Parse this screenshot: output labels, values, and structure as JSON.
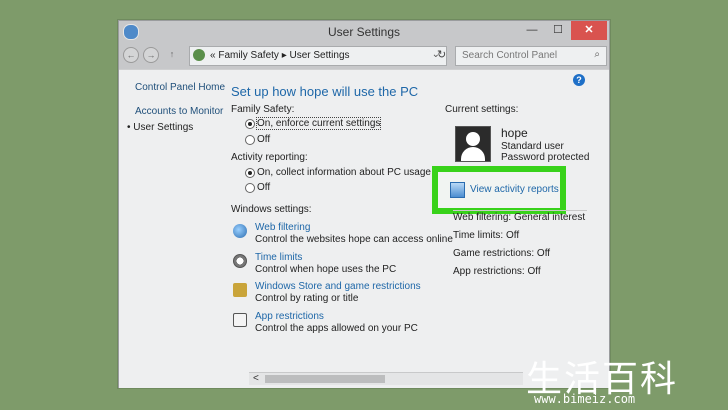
{
  "window": {
    "title": "User Settings",
    "controls": {
      "minimize": "—",
      "maximize": "☐",
      "close": "✕"
    }
  },
  "navbar": {
    "back": "←",
    "forward": "→",
    "up": "↑",
    "breadcrumb": "« Family Safety ▸ User Settings",
    "dropdown": "⌄",
    "refresh": "↻",
    "search_placeholder": "Search Control Panel",
    "search_icon": "⌕"
  },
  "leftnav": {
    "items": [
      {
        "label": "Control Panel Home"
      },
      {
        "label": "Accounts to Monitor"
      },
      {
        "label": "• User Settings"
      }
    ]
  },
  "help": {
    "label": "?"
  },
  "main": {
    "heading": "Set up how hope will use the PC",
    "family_safety": {
      "label": "Family Safety:",
      "options": [
        "On, enforce current settings",
        "Off"
      ],
      "selected": "On, enforce current settings"
    },
    "activity_reporting": {
      "label": "Activity reporting:",
      "options": [
        "On, collect information about PC usage",
        "Off"
      ],
      "selected": "On, collect information about PC usage"
    },
    "windows_settings": {
      "label": "Windows settings:",
      "items": [
        {
          "icon": "globe-icon",
          "title": "Web filtering",
          "desc": "Control the websites hope can access online"
        },
        {
          "icon": "clock-icon",
          "title": "Time limits",
          "desc": "Control when hope uses the PC"
        },
        {
          "icon": "trophy-icon",
          "title": "Windows Store and game restrictions",
          "desc": "Control by rating or title"
        },
        {
          "icon": "app-icon",
          "title": "App restrictions",
          "desc": "Control the apps allowed on your PC"
        }
      ]
    }
  },
  "current_settings": {
    "label": "Current settings:",
    "user": {
      "name": "hope",
      "type": "Standard user",
      "password": "Password protected"
    },
    "report_link": "View activity reports",
    "rows": [
      "Web filtering: General interest",
      "Time limits: Off",
      "Game restrictions: Off",
      "App restrictions: Off"
    ]
  },
  "scroll": {
    "left_arrow": "<"
  },
  "watermark": {
    "chars": "生活百科",
    "url": "www.bimeiz.com"
  },
  "colors": {
    "accent": "#1e67a8",
    "highlight": "#38d21a",
    "background": "#7e9b6a"
  }
}
